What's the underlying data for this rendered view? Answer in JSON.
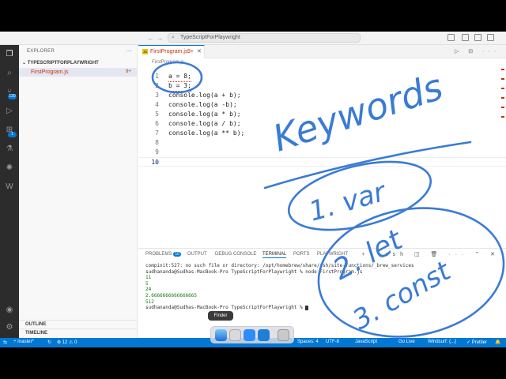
{
  "titlebar": {
    "search_text": "TypeScriptForPlaywright",
    "nav": "← →"
  },
  "activity": {
    "badge_source_control": "120",
    "badge_extensions": "1"
  },
  "sidebar": {
    "title": "EXPLORER",
    "folder": "TYPESCRIPTFORPLAYWRIGHT",
    "file": {
      "name": "FirstProgram.js",
      "problems": "9+"
    },
    "outline": "OUTLINE",
    "timeline": "TIMELINE"
  },
  "editor": {
    "tab": {
      "name": "FirstProgram.js",
      "badge": "9+"
    },
    "breadcrumb": "FirstProgram.js",
    "lines": [
      {
        "n": "1",
        "text": "a = 8;"
      },
      {
        "n": "2",
        "text": "b = 3;"
      },
      {
        "n": "3",
        "text": "console.log(a + b);"
      },
      {
        "n": "4",
        "text": "console.log(a -b);"
      },
      {
        "n": "5",
        "text": "console.log(a * b);"
      },
      {
        "n": "6",
        "text": "console.log(a / b);"
      },
      {
        "n": "7",
        "text": "console.log(a ** b);"
      },
      {
        "n": "8",
        "text": ""
      },
      {
        "n": "9",
        "text": ""
      },
      {
        "n": "10",
        "text": ""
      }
    ]
  },
  "panel": {
    "tabs": {
      "problems": "PROBLEMS",
      "problems_count": "10",
      "output": "OUTPUT",
      "debug": "DEBUG CONSOLE",
      "terminal": "TERMINAL",
      "ports": "PORTS",
      "playwright": "PLAYWRIGHT"
    },
    "shell": "zsh",
    "terminal": [
      "compinit:527: no such file or directory: /opt/homebrew/share/zsh/site-functions/_brew_services",
      "sudhananda@Sudhas-MacBook-Pro TypeScriptForPlaywright % node FirstProgram.js",
      "11",
      "5",
      "24",
      "2.6666666666666665",
      "512",
      "sudhananda@Sudhas-MacBook-Pro TypeScriptForPlaywright % "
    ]
  },
  "statusbar": {
    "branch": "master*",
    "problems": "⊗ 12 ⚠ 0",
    "spaces": "Spaces: 4",
    "encoding": "UTF-8",
    "language": "JavaScript",
    "golive": "Go Live",
    "windsurf": "Windsurf: {...}",
    "prettier": "✓ Prettier"
  },
  "dock": {
    "tooltip": "Finder"
  },
  "annotations": {
    "heading": "Keywords",
    "item1": "1. var",
    "item2": "2. let",
    "item3": "3. const"
  }
}
